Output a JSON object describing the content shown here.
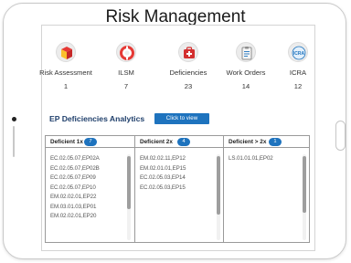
{
  "app": {
    "title": "Risk Management"
  },
  "modules": [
    {
      "label": "Risk Assessment",
      "count": "1",
      "icon": "risk-assessment-icon",
      "color": "#e53935"
    },
    {
      "label": "ILSM",
      "count": "7",
      "icon": "lifebuoy-icon",
      "color": "#e53935"
    },
    {
      "label": "Deficiencies",
      "count": "23",
      "icon": "first-aid-kit-icon",
      "color": "#d32f2f"
    },
    {
      "label": "Work Orders",
      "count": "14",
      "icon": "clipboard-icon",
      "color": "#8d8d8d"
    },
    {
      "label": "ICRA",
      "count": "12",
      "icon": "icra-icon",
      "color": "#1e73be"
    }
  ],
  "analytics": {
    "title": "EP Deficiencies Analytics",
    "button_label": "Click to view"
  },
  "panels": [
    {
      "label": "Deficient 1x",
      "badge": "7",
      "items": [
        "EC.02.05.07,EP02A",
        "EC.02.05.07,EP02B",
        "EC.02.05.07,EP09",
        "EC.02.05.07,EP10",
        "EM.02.02.01,EP22",
        "EM.03.01.03,EP01",
        "EM.02.02.01,EP20"
      ]
    },
    {
      "label": "Deficient  2x",
      "badge": "4",
      "items": [
        "EM.02.02.11,EP12",
        "EM.02.01.01,EP15",
        "EC.02.05.03,EP14",
        "EC.02.05.03,EP15"
      ]
    },
    {
      "label": "Deficient > 2x",
      "badge": "1",
      "items": [
        "LS.01.01.01,EP02"
      ]
    }
  ],
  "colors": {
    "accent": "#1e73be",
    "title_blue": "#1f3f6b"
  }
}
